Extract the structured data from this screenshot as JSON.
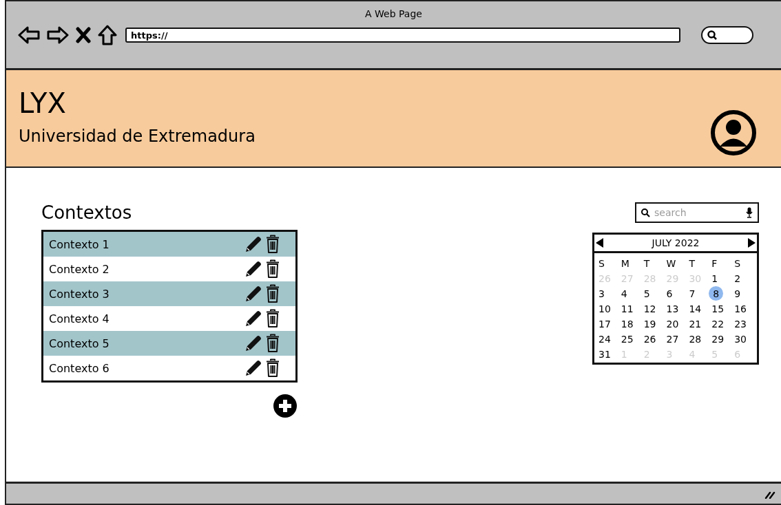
{
  "browser": {
    "title": "A Web Page",
    "url": "https://"
  },
  "header": {
    "logo": "LYX",
    "subtitle": "Universidad de Extremadura"
  },
  "contexts": {
    "title": "Contextos",
    "items": [
      {
        "label": "Contexto 1"
      },
      {
        "label": "Contexto 2"
      },
      {
        "label": "Contexto 3"
      },
      {
        "label": "Contexto 4"
      },
      {
        "label": "Contexto 5"
      },
      {
        "label": "Contexto 6"
      }
    ]
  },
  "search": {
    "placeholder": "search"
  },
  "calendar": {
    "month": "JULY 2022",
    "weekdays": [
      "S",
      "M",
      "T",
      "W",
      "T",
      "F",
      "S"
    ],
    "days": [
      {
        "label": "26",
        "muted": true,
        "selected": false
      },
      {
        "label": "27",
        "muted": true,
        "selected": false
      },
      {
        "label": "28",
        "muted": true,
        "selected": false
      },
      {
        "label": "29",
        "muted": true,
        "selected": false
      },
      {
        "label": "30",
        "muted": true,
        "selected": false
      },
      {
        "label": "1",
        "muted": false,
        "selected": false
      },
      {
        "label": "2",
        "muted": false,
        "selected": false
      },
      {
        "label": "3",
        "muted": false,
        "selected": false
      },
      {
        "label": "4",
        "muted": false,
        "selected": false
      },
      {
        "label": "5",
        "muted": false,
        "selected": false
      },
      {
        "label": "6",
        "muted": false,
        "selected": false
      },
      {
        "label": "7",
        "muted": false,
        "selected": false
      },
      {
        "label": "8",
        "muted": false,
        "selected": true
      },
      {
        "label": "9",
        "muted": false,
        "selected": false
      },
      {
        "label": "10",
        "muted": false,
        "selected": false
      },
      {
        "label": "11",
        "muted": false,
        "selected": false
      },
      {
        "label": "12",
        "muted": false,
        "selected": false
      },
      {
        "label": "13",
        "muted": false,
        "selected": false
      },
      {
        "label": "14",
        "muted": false,
        "selected": false
      },
      {
        "label": "15",
        "muted": false,
        "selected": false
      },
      {
        "label": "16",
        "muted": false,
        "selected": false
      },
      {
        "label": "17",
        "muted": false,
        "selected": false
      },
      {
        "label": "18",
        "muted": false,
        "selected": false
      },
      {
        "label": "19",
        "muted": false,
        "selected": false
      },
      {
        "label": "20",
        "muted": false,
        "selected": false
      },
      {
        "label": "21",
        "muted": false,
        "selected": false
      },
      {
        "label": "22",
        "muted": false,
        "selected": false
      },
      {
        "label": "23",
        "muted": false,
        "selected": false
      },
      {
        "label": "24",
        "muted": false,
        "selected": false
      },
      {
        "label": "25",
        "muted": false,
        "selected": false
      },
      {
        "label": "26",
        "muted": false,
        "selected": false
      },
      {
        "label": "27",
        "muted": false,
        "selected": false
      },
      {
        "label": "28",
        "muted": false,
        "selected": false
      },
      {
        "label": "29",
        "muted": false,
        "selected": false
      },
      {
        "label": "30",
        "muted": false,
        "selected": false
      },
      {
        "label": "31",
        "muted": false,
        "selected": false
      },
      {
        "label": "1",
        "muted": true,
        "selected": false
      },
      {
        "label": "2",
        "muted": true,
        "selected": false
      },
      {
        "label": "3",
        "muted": true,
        "selected": false
      },
      {
        "label": "4",
        "muted": true,
        "selected": false
      },
      {
        "label": "5",
        "muted": true,
        "selected": false
      },
      {
        "label": "6",
        "muted": true,
        "selected": false
      }
    ]
  }
}
